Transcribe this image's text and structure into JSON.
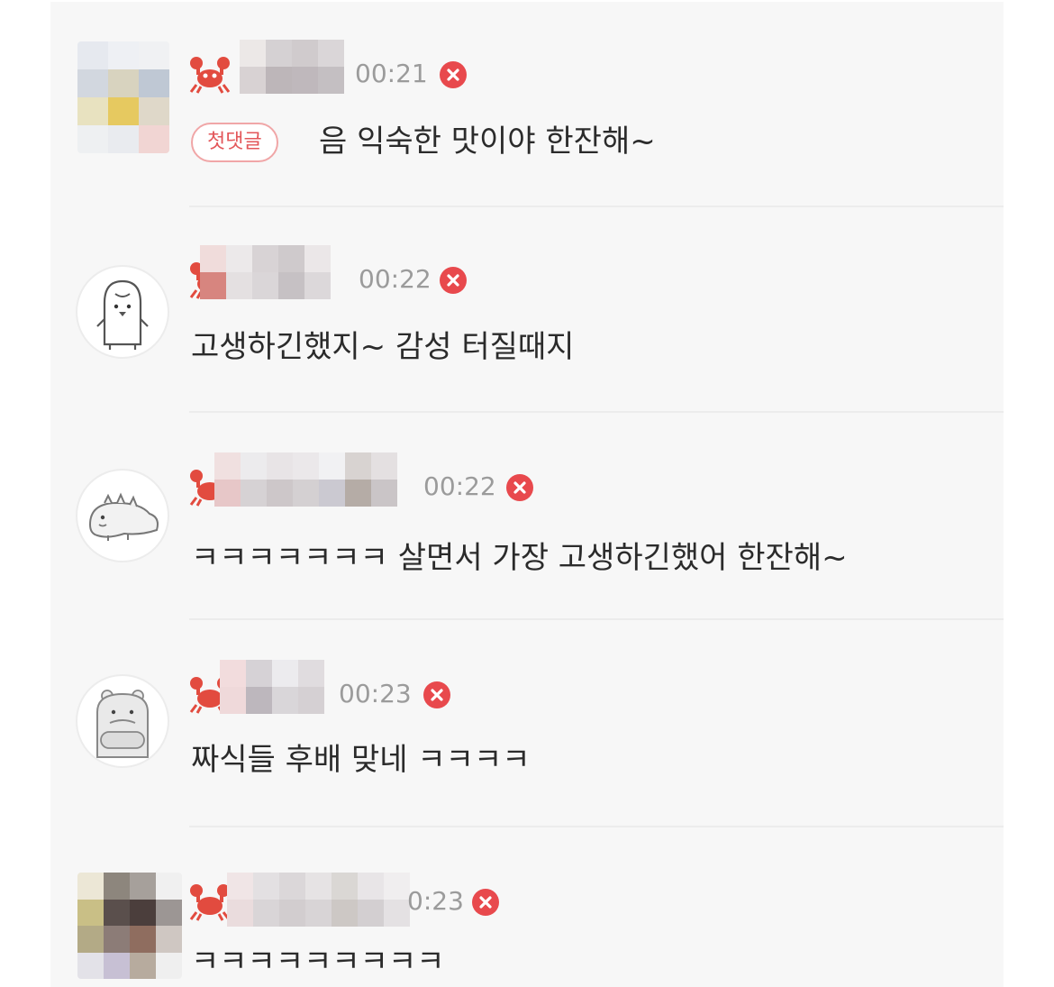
{
  "comments": [
    {
      "time": "00:21",
      "badge": "첫댓글",
      "text": "음 익숙한 맛이야 한잔해~",
      "avatar": "pixelated-photo-avatar",
      "colors": [
        "#e6e9ef",
        "#eef0f4",
        "#f0f1f3",
        "#d2d7df",
        "#d8d3bf",
        "#bfc8d4",
        "#e8e2c0",
        "#e6c960",
        "#dfd8c9",
        "#eef0f2",
        "#e9ebef",
        "#f1d5d3"
      ]
    },
    {
      "time": "00:22",
      "badge": "",
      "text": "고생하긴했지~ 감성 터질때지",
      "avatar": "penguin-character-avatar"
    },
    {
      "time": "00:22",
      "badge": "",
      "text": "ㅋㅋㅋㅋㅋㅋㅋ 살면서 가장 고생하긴했어 한잔해~",
      "avatar": "dinosaur-character-avatar"
    },
    {
      "time": "00:23",
      "badge": "",
      "text": "짜식들 후배 맞네 ㅋㅋㅋㅋ",
      "avatar": "hippo-character-avatar"
    },
    {
      "time": "0:23",
      "badge": "",
      "text": "ㅋㅋㅋㅋㅋㅋㅋㅋㅋ",
      "avatar": "pixelated-photo-avatar",
      "colors": [
        "#ece7d6",
        "#8d867d",
        "#a6a09b",
        "#f0f0f0",
        "#c9bf86",
        "#5a4f4c",
        "#4b3e3c",
        "#9c9694",
        "#b3aa86",
        "#8c7c77",
        "#8f6d5f",
        "#cfc7c2",
        "#e3e2e8",
        "#c7c0d4",
        "#b7ab9e",
        "#efefef"
      ]
    }
  ],
  "icons": {
    "level": "crab-icon",
    "delete": "delete-icon"
  },
  "colors": {
    "background": "#f7f7f7",
    "delete": "#e8494d",
    "badge_border": "#f0a6a7",
    "badge_text": "#e35659",
    "time": "#9b9b9b",
    "text": "#2b2b2b"
  }
}
